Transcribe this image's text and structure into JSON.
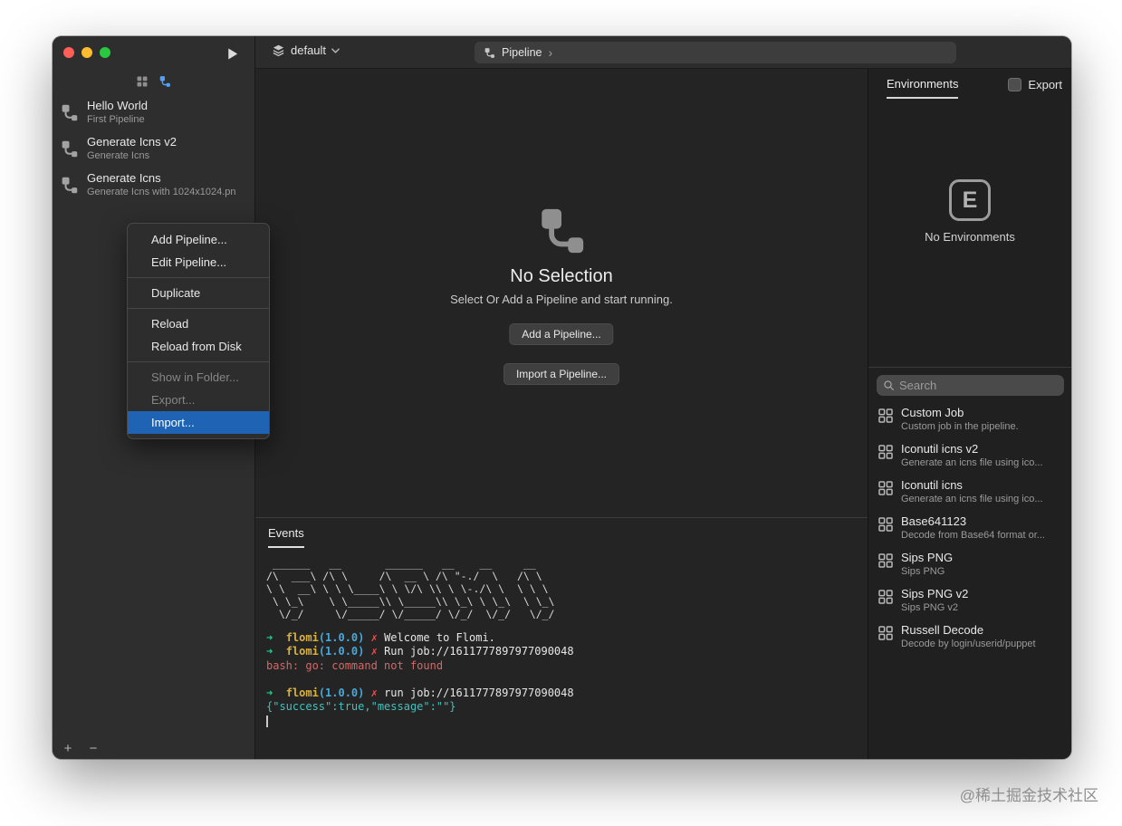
{
  "watermark": "@稀土掘金技术社区",
  "colors": {
    "accent_blue": "#1e63b4",
    "traffic_red": "#ff5f57",
    "traffic_yellow": "#febc2e",
    "traffic_green": "#28c840",
    "terminal_green": "#23d18b",
    "terminal_gold": "#d9b23d",
    "terminal_blue": "#46a9dd",
    "terminal_red": "#ef5350",
    "terminal_error": "#d16969",
    "terminal_cyan": "#43c1bd"
  },
  "toolbar": {
    "project": "default",
    "breadcrumb": "Pipeline",
    "breadcrumb_chevron": "›"
  },
  "sidebar": {
    "pipelines": [
      {
        "title": "Hello World",
        "subtitle": "First Pipeline"
      },
      {
        "title": "Generate Icns v2",
        "subtitle": "Generate Icns"
      },
      {
        "title": "Generate Icns",
        "subtitle": "Generate Icns with 1024x1024.pn"
      }
    ],
    "add_label": "+",
    "remove_label": "−"
  },
  "context_menu": {
    "items": [
      {
        "label": "Add Pipeline...",
        "state": "normal"
      },
      {
        "label": "Edit Pipeline...",
        "state": "normal"
      },
      {
        "type": "separator"
      },
      {
        "label": "Duplicate",
        "state": "normal"
      },
      {
        "type": "separator"
      },
      {
        "label": "Reload",
        "state": "normal"
      },
      {
        "label": "Reload from Disk",
        "state": "normal"
      },
      {
        "type": "separator"
      },
      {
        "label": "Show in Folder...",
        "state": "disabled"
      },
      {
        "label": "Export...",
        "state": "disabled"
      },
      {
        "label": "Import...",
        "state": "selected"
      }
    ]
  },
  "main": {
    "empty": {
      "title": "No Selection",
      "subtitle": "Select Or Add a Pipeline and start running.",
      "add_button": "Add a Pipeline...",
      "import_button": "Import a Pipeline..."
    },
    "events": {
      "tab": "Events",
      "ascii_art": [
        " ______   __       ______   __    __     __    ",
        "/\\  ___\\ /\\ \\     /\\  __ \\ /\\ \"-./  \\   /\\ \\   ",
        "\\ \\  __\\ \\ \\ \\____\\ \\ \\/\\ \\\\ \\ \\-./\\ \\  \\ \\ \\  ",
        " \\ \\_\\    \\ \\_____\\\\ \\_____\\\\ \\_\\ \\ \\_\\  \\ \\_\\ ",
        "  \\/_/     \\/_____/ \\/_____/ \\/_/  \\/_/   \\/_/ "
      ],
      "terminal_lines": [
        {
          "segments": [
            {
              "text": "➜  ",
              "color": "green"
            },
            {
              "text": "flomi",
              "color": "gold"
            },
            {
              "text": "(1.0.0)",
              "color": "blue"
            },
            {
              "text": " ✗ ",
              "color": "red"
            },
            {
              "text": "Welcome to Flomi.",
              "color": "white"
            }
          ]
        },
        {
          "segments": [
            {
              "text": "➜  ",
              "color": "green"
            },
            {
              "text": "flomi",
              "color": "gold"
            },
            {
              "text": "(1.0.0)",
              "color": "blue"
            },
            {
              "text": " ✗ ",
              "color": "red"
            },
            {
              "text": "Run job://1611777897977090048",
              "color": "white"
            }
          ]
        },
        {
          "segments": [
            {
              "text": "bash: go: command not found",
              "color": "error"
            }
          ]
        },
        {
          "segments": []
        },
        {
          "segments": [
            {
              "text": "➜  ",
              "color": "green"
            },
            {
              "text": "flomi",
              "color": "gold"
            },
            {
              "text": "(1.0.0)",
              "color": "blue"
            },
            {
              "text": " ✗ ",
              "color": "red"
            },
            {
              "text": "run job://1611777897977090048",
              "color": "white"
            }
          ]
        },
        {
          "segments": [
            {
              "text": "{\"success\":true,\"message\":\"\"}",
              "color": "cyan"
            }
          ]
        }
      ]
    }
  },
  "right_panel": {
    "tab": "Environments",
    "export_label": "Export",
    "env_icon_letter": "E",
    "empty_text": "No Environments",
    "search_placeholder": "Search",
    "jobs": [
      {
        "title": "Custom Job",
        "subtitle": "Custom job in the pipeline."
      },
      {
        "title": "Iconutil icns v2",
        "subtitle": "Generate an icns file using ico..."
      },
      {
        "title": "Iconutil icns",
        "subtitle": "Generate an icns file using ico..."
      },
      {
        "title": "Base641123",
        "subtitle": "Decode from Base64 format or..."
      },
      {
        "title": "Sips PNG",
        "subtitle": "Sips PNG"
      },
      {
        "title": "Sips PNG v2",
        "subtitle": "Sips PNG v2"
      },
      {
        "title": "Russell Decode",
        "subtitle": "Decode by login/userid/puppet"
      }
    ]
  }
}
